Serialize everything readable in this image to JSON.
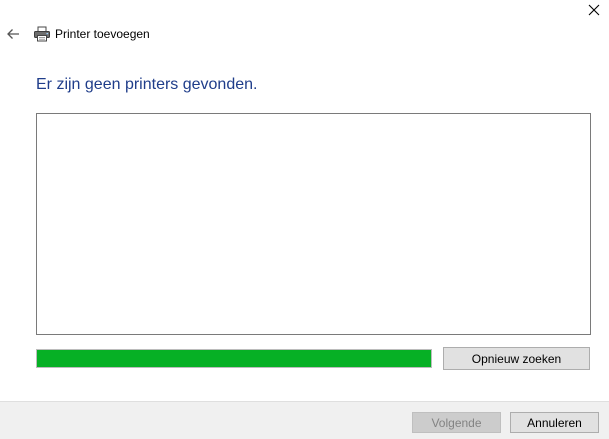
{
  "window": {
    "title": "Printer toevoegen",
    "close_icon": "close-icon",
    "back_icon": "back-arrow-icon",
    "app_icon": "printer-icon"
  },
  "main": {
    "heading": "Er zijn geen printers gevonden.",
    "results": [],
    "search_progress": 1.0,
    "search_again_label": "Opnieuw zoeken"
  },
  "footer": {
    "next_label": "Volgende",
    "next_enabled": false,
    "cancel_label": "Annuleren"
  },
  "colors": {
    "heading": "#1f3d8a",
    "progress_fill": "#06b025",
    "footer_background": "#f0f0f0"
  }
}
